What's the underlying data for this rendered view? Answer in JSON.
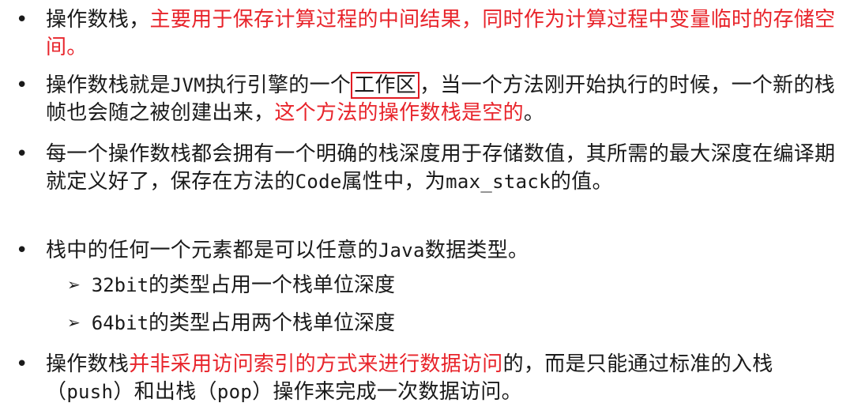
{
  "bullet": "•",
  "arrow": "➢",
  "items": [
    {
      "p1": "操作数栈，",
      "p2": "主要用于保存计算过程的中间结果，同时作为计算过程中变量临时的存储空间。"
    },
    {
      "p1": "操作数栈就是",
      "p2": "JVM",
      "p3": "执行引擎的一个",
      "p4": "工作区",
      "p5": "，当一个方法刚开始执行的时候，一个新的栈帧也会随之被创建出来，",
      "p6": "这个方法的操作数栈是空的",
      "p7": "。"
    },
    {
      "p1": "每一个操作数栈都会拥有一个明确的栈深度用于存储数值，其所需的最大深度在编译期就定义好了，保存在方法的",
      "p2": "Code",
      "p3": "属性中，为",
      "p4": "max_stack",
      "p5": "的值。"
    },
    {
      "p1": "栈中的任何一个元素都是可以任意的",
      "p2": "Java",
      "p3": "数据类型。",
      "sub": [
        {
          "a": "32bit",
          "b": "的类型占用一个栈单位深度"
        },
        {
          "a": "64bit",
          "b": "的类型占用两个栈单位深度"
        }
      ]
    },
    {
      "p1": "操作数栈",
      "p2": "并非采用访问索引的方式来进行数据访问",
      "p3": "的，而是只能通过标准的入栈（",
      "p4": "push",
      "p5": "）和出栈（",
      "p6": "pop",
      "p7": "）操作来完成一次数据访问。"
    }
  ]
}
